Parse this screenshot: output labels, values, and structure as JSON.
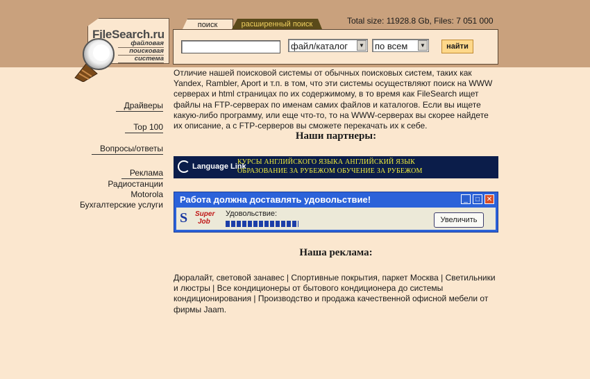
{
  "header": {
    "logo_name": "FileSearch.ru",
    "logo_tagline": [
      "файловая",
      "поисковая",
      "система"
    ],
    "tab_search": "поиск",
    "tab_advanced": "расширенный поиск",
    "total_stats": "Total size: 11928.8 Gb, Files: 7 051 000",
    "search_value": "",
    "select_type": "файл/каталог",
    "select_scope": "по всем",
    "find_button": "найти"
  },
  "nav": {
    "drivers": "Драйверы",
    "top100": "Top 100",
    "faq": "Вопросы/ответы",
    "ads": "Реклама",
    "radio": "Радиостанции",
    "motorola": "Motorola",
    "accounting": "Бухгалтерские услуги"
  },
  "main": {
    "intro": "Отличие нашей поисковой системы от обычных поисковых систем, таких как Yandex, Rambler, Aport и т.п. в том, что эти системы осуществляют поиск на WWW серверах и html страницах по их содержимому, в то время как FileSearch ищет файлы на FTP-серверах по именам самих файлов и каталогов. Если вы ищете какую-либо программу, или еще что-то, то на WWW-серверах вы скорее найдете их описание, а с FTP-серверов вы сможете перекачать их к себе.",
    "partners_heading": "Наши партнеры:",
    "our_ads_heading": "Наша реклама:",
    "ads_text": "Дюралайт, световой занавес | Спортивные покрытия, паркет Москва | Светильники и люстры | Все кондиционеры от бытового кондиционера до системы кондиционирования | Производство и продажа качественной офисной мебели от фирмы Jaam."
  },
  "language_link": {
    "logo": "Language Link",
    "line1": "КУРСЫ АНГЛИЙСКОГО ЯЗЫКА  АНГЛИЙСКИЙ ЯЗЫК",
    "line2": "ОБРАЗОВАНИЕ ЗА РУБЕЖОМ    ОБУЧЕНИЕ ЗА РУБЕЖОМ"
  },
  "superjob": {
    "title": "Работа должна доставлять удовольствие!",
    "logo_super": "Super",
    "logo_job": "Job",
    "label": "Удовольствие:",
    "button": "Увеличить"
  },
  "colors": {
    "page_bg": "#fbe7cf",
    "header_band": "#c9a17d",
    "language_link_bg": "#0b1d4a",
    "superjob_blue": "#2b62d9"
  }
}
